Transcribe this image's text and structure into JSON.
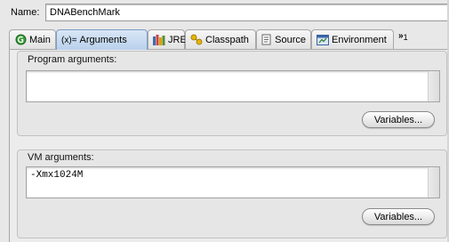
{
  "name": {
    "label": "Name:",
    "value": "DNABenchMark"
  },
  "tabs": [
    {
      "label": "Main",
      "icon": "green-circle-icon"
    },
    {
      "label": "Arguments",
      "icon": "variable-x-icon",
      "prefix": "(x)="
    },
    {
      "label": "JRE",
      "icon": "library-books-icon"
    },
    {
      "label": "Classpath",
      "icon": "classpath-nodes-icon"
    },
    {
      "label": "Source",
      "icon": "source-doc-icon"
    },
    {
      "label": "Environment",
      "icon": "environment-window-icon"
    }
  ],
  "overflow": {
    "chevron": "»",
    "count": "1"
  },
  "program_args": {
    "title": "Program arguments:",
    "value": "",
    "variables_label": "Variables..."
  },
  "vm_args": {
    "title": "VM arguments:",
    "value": "-Xmx1024M",
    "variables_label": "Variables..."
  },
  "colors": {
    "active_tab": "#b9d1ec",
    "background": "#e8e8e8"
  }
}
